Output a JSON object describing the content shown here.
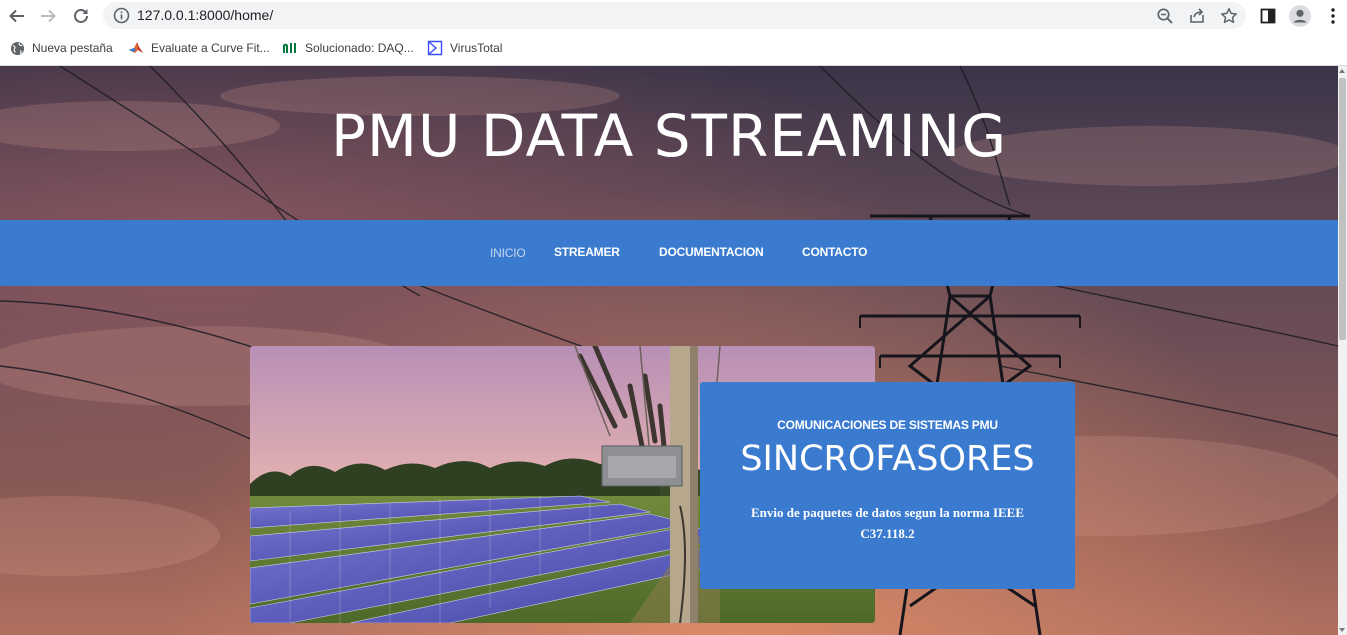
{
  "browser": {
    "url": "127.0.0.1:8000/home/",
    "bookmarks": [
      {
        "label": "Nueva pestaña",
        "icon": "globe-icon"
      },
      {
        "label": "Evaluate a Curve Fit...",
        "icon": "matlab-icon"
      },
      {
        "label": "Solucionado: DAQ...",
        "icon": "ni-icon"
      },
      {
        "label": "VirusTotal",
        "icon": "virustotal-icon"
      }
    ]
  },
  "site": {
    "title": "PMU DATA STREAMING",
    "nav": [
      {
        "label": "INICIO",
        "active": true
      },
      {
        "label": "STREAMER",
        "active": false
      },
      {
        "label": "DOCUMENTACION",
        "active": false
      },
      {
        "label": "CONTACTO",
        "active": false
      }
    ],
    "card": {
      "kicker": "COMUNICACIONES DE SISTEMAS PMU",
      "headline": "SINCROFASORES",
      "description_line1": "Envio de paquetes de datos segun la norma IEEE",
      "description_line2": "C37.118.2"
    }
  },
  "colors": {
    "nav_blue": "#3a7bd0",
    "chrome_bg": "#ffffff",
    "omnibox_bg": "#f1f3f4"
  }
}
